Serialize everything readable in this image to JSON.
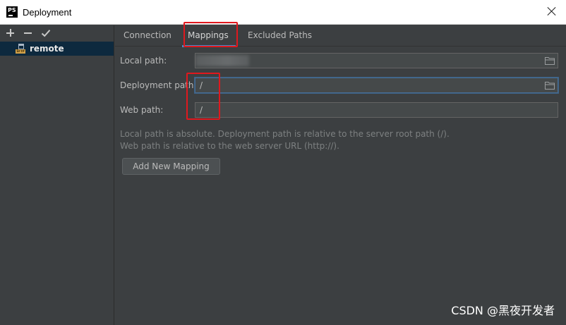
{
  "window": {
    "title": "Deployment",
    "app_icon_text": "PS"
  },
  "left_panel": {
    "toolbar": {
      "add_icon": "plus-icon",
      "remove_icon": "minus-icon",
      "apply_icon": "check-icon"
    },
    "servers": [
      {
        "label": "remote",
        "icon": "sftp-server-icon",
        "icon_text": "SFTP"
      }
    ]
  },
  "tabs": [
    {
      "label": "Connection"
    },
    {
      "label": "Mappings",
      "selected": true
    },
    {
      "label": "Excluded Paths"
    }
  ],
  "form": {
    "local_path": {
      "label": "Local path:",
      "value": ""
    },
    "deployment_path": {
      "label": "Deployment path:",
      "value": "/"
    },
    "web_path": {
      "label": "Web path:",
      "value": "/"
    }
  },
  "hints": {
    "line1": "Local path is absolute. Deployment path is relative to the server root path (/).",
    "line2": "Web path is relative to the web server URL (http://)."
  },
  "buttons": {
    "add_mapping": "Add New Mapping"
  },
  "watermark": "CSDN @黑夜开发者",
  "colors": {
    "accent": "#4a88c7",
    "highlight": "#e0181e",
    "selection": "#0d293e"
  }
}
